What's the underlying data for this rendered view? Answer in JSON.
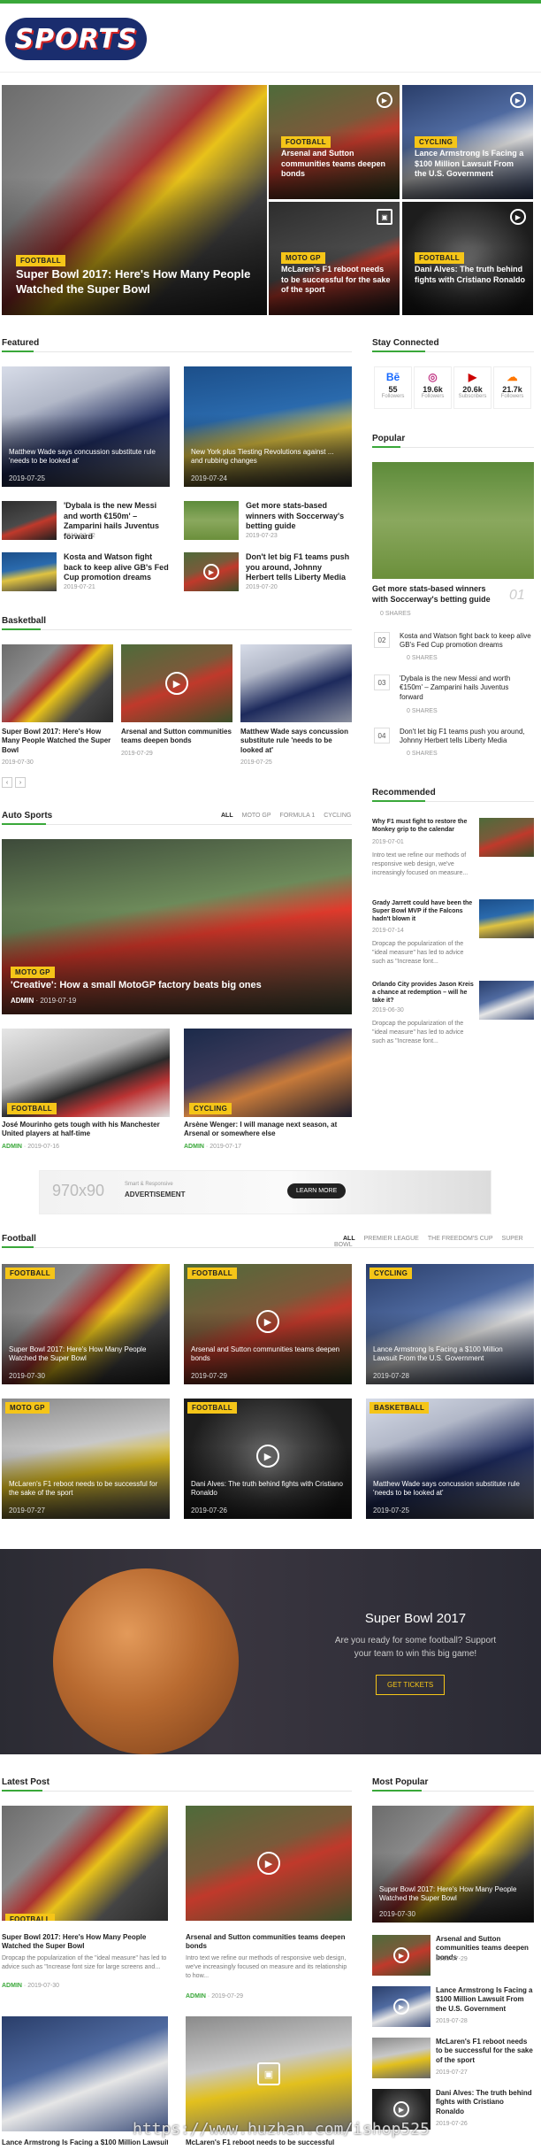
{
  "brand": {
    "logo_text": "SPORTS",
    "accent": "#3aa83a",
    "tag_color": "#f5c518"
  },
  "hero": {
    "main": {
      "category": "FOOTBALL",
      "title": "Super Bowl 2017: Here's How Many People Watched the Super Bowl"
    },
    "grid": [
      {
        "category": "FOOTBALL",
        "title": "Arsenal and Sutton communities teams deepen bonds",
        "icon": "play-icon"
      },
      {
        "category": "CYCLING",
        "title": "Lance Armstrong Is Facing a $100 Million Lawsuit From the U.S. Government",
        "icon": "play-icon"
      },
      {
        "category": "MOTO GP",
        "title": "McLaren's F1 reboot needs to be successful for the sake of the sport",
        "icon": "image-icon"
      },
      {
        "category": "FOOTBALL",
        "title": "Dani Alves: The truth behind fights with Cristiano Ronaldo",
        "icon": "play-icon"
      }
    ]
  },
  "featured": {
    "title": "Featured",
    "big": [
      {
        "title": "Matthew Wade says concussion substitute rule 'needs to be looked at'",
        "date": "2019-07-25"
      },
      {
        "title": "New York plus Tiesting Revolutions against ... and rubbing changes",
        "date": "2019-07-24"
      }
    ],
    "small": [
      {
        "title": "'Dybala is the new Messi and worth €150m' – Zamparini hails Juventus forward",
        "date": "2019-07-22"
      },
      {
        "title": "Get more stats-based winners with Soccerway's betting guide",
        "date": "2019-07-23"
      },
      {
        "title": "Kosta and Watson fight back to keep alive GB's Fed Cup promotion dreams",
        "date": "2019-07-21"
      },
      {
        "title": "Don't let big F1 teams push you around, Johnny Herbert tells Liberty Media",
        "date": "2019-07-20"
      }
    ]
  },
  "basketball": {
    "title": "Basketball",
    "items": [
      {
        "title": "Super Bowl 2017: Here's How Many People Watched the Super Bowl",
        "date": "2019-07-30"
      },
      {
        "title": "Arsenal and Sutton communities teams deepen bonds",
        "date": "2019-07-29"
      },
      {
        "title": "Matthew Wade says concussion substitute rule 'needs to be looked at'",
        "date": "2019-07-25"
      }
    ],
    "prev": "‹",
    "next": "›"
  },
  "stay": {
    "title": "Stay Connected",
    "items": [
      {
        "icon": "Bē",
        "count": "55",
        "label": "Followers",
        "color": "#1769ff"
      },
      {
        "icon": "◎",
        "count": "19.6k",
        "label": "Followers",
        "color": "#c13584"
      },
      {
        "icon": "▶",
        "count": "20.6k",
        "label": "Subscribers",
        "color": "#cc0000"
      },
      {
        "icon": "☁",
        "count": "21.7k",
        "label": "Followers",
        "color": "#ff7700"
      }
    ]
  },
  "popular": {
    "title": "Popular",
    "top": {
      "title": "Get more stats-based winners with Soccerway's betting guide",
      "rank": "01",
      "shares": "0 SHARES"
    },
    "list": [
      {
        "rank": "02",
        "title": "Kosta and Watson fight back to keep alive GB's Fed Cup promotion dreams",
        "shares": "0 SHARES"
      },
      {
        "rank": "03",
        "title": "'Dybala is the new Messi and worth €150m' – Zamparini hails Juventus forward",
        "shares": "0 SHARES"
      },
      {
        "rank": "04",
        "title": "Don't let big F1 teams push you around, Johnny Herbert tells Liberty Media",
        "shares": "0 SHARES"
      }
    ]
  },
  "recommended": {
    "title": "Recommended",
    "items": [
      {
        "title": "Why F1 must fight to restore the Monkey grip to the calendar",
        "date": "2019-07-01",
        "excerpt": "Intro text we refine our methods of responsive web design, we've increasingly focused on measure..."
      },
      {
        "title": "Grady Jarrett could have been the Super Bowl MVP if the Falcons hadn't blown it",
        "date": "2019-07-14",
        "excerpt": "Dropcap the popularization of the \"ideal measure\" has led to advice such as \"Increase font..."
      },
      {
        "title": "Orlando City provides Jason Kreis a chance at redemption – will he take it?",
        "date": "2019-06-30",
        "excerpt": "Dropcap the popularization of the \"ideal measure\" has led to advice such as \"Increase font..."
      }
    ]
  },
  "auto": {
    "title": "Auto Sports",
    "tabs": [
      "ALL",
      "MOTO GP",
      "FORMULA 1",
      "CYCLING"
    ],
    "big": {
      "category": "MOTO GP",
      "title": "'Creative': How a small MotoGP factory beats big ones",
      "author": "ADMIN",
      "date": "2019-07-19"
    },
    "small": [
      {
        "category": "FOOTBALL",
        "title": "José Mourinho gets tough with his Manchester United players at half-time",
        "author": "ADMIN",
        "date": "2019-07-16"
      },
      {
        "category": "CYCLING",
        "title": "Arsène Wenger: I will manage next season, at Arsenal or somewhere else",
        "author": "ADMIN",
        "date": "2019-07-17"
      }
    ]
  },
  "ad": {
    "size": "970x90",
    "line1": "Smart & Responsive",
    "line2": "ADVERTISEMENT",
    "button": "LEARN MORE"
  },
  "football": {
    "title": "Football",
    "tabs": [
      "ALL",
      "PREMIER LEAGUE",
      "THE FREEDOM'S CUP",
      "SUPER BOWL"
    ],
    "items": [
      {
        "category": "FOOTBALL",
        "title": "Super Bowl 2017: Here's How Many People Watched the Super Bowl",
        "date": "2019-07-30"
      },
      {
        "category": "FOOTBALL",
        "title": "Arsenal and Sutton communities teams deepen bonds",
        "date": "2019-07-29"
      },
      {
        "category": "CYCLING",
        "title": "Lance Armstrong Is Facing a $100 Million Lawsuit From the U.S. Government",
        "date": "2019-07-28"
      },
      {
        "category": "MOTO GP",
        "title": "McLaren's F1 reboot needs to be successful for the sake of the sport",
        "date": "2019-07-27"
      },
      {
        "category": "FOOTBALL",
        "title": "Dani Alves: The truth behind fights with Cristiano Ronaldo",
        "date": "2019-07-26"
      },
      {
        "category": "BASKETBALL",
        "title": "Matthew Wade says concussion substitute rule 'needs to be looked at'",
        "date": "2019-07-25"
      }
    ]
  },
  "banner": {
    "title": "Super Bowl 2017",
    "text": "Are you ready for some football? Support your team to win this big game!",
    "button": "GET TICKETS"
  },
  "latest": {
    "title": "Latest Post",
    "items": [
      {
        "category": "FOOTBALL",
        "title": "Super Bowl 2017: Here's How Many People Watched the Super Bowl",
        "excerpt": "Dropcap the popularization of the \"ideal measure\" has led to advice such as \"Increase font size for large screens and...",
        "author": "ADMIN",
        "date": "2019-07-30"
      },
      {
        "category": "",
        "title": "Arsenal and Sutton communities teams deepen bonds",
        "excerpt": "Intro text we refine our methods of responsive web design, we've increasingly focused on measure and its relationship to how...",
        "author": "ADMIN",
        "date": "2019-07-29"
      }
    ],
    "bottom": [
      {
        "title": "Lance Armstrong Is Facing a $100 Million Lawsuit"
      },
      {
        "title": "McLaren's F1 reboot needs to be successful"
      }
    ]
  },
  "most": {
    "title": "Most Popular",
    "top": {
      "title": "Super Bowl 2017: Here's How Many People Watched the Super Bowl",
      "date": "2019-07-30"
    },
    "list": [
      {
        "title": "Arsenal and Sutton communities teams deepen bonds",
        "date": "2019-07-29"
      },
      {
        "title": "Lance Armstrong Is Facing a $100 Million Lawsuit From the U.S. Government",
        "date": "2019-07-28"
      },
      {
        "title": "McLaren's F1 reboot needs to be successful for the sake of the sport",
        "date": "2019-07-27"
      },
      {
        "title": "Dani Alves: The truth behind fights with Cristiano Ronaldo",
        "date": "2019-07-26"
      }
    ]
  },
  "watermark": "https://www.huzhan.com/ishop525"
}
